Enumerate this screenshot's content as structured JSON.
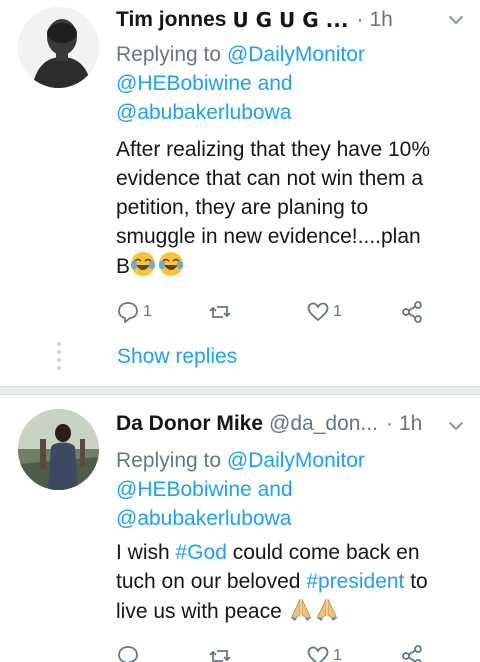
{
  "tweets": [
    {
      "name": "Tim jonnes",
      "name_suffix": "U G U G ...",
      "handle": "",
      "time": "1h",
      "replying_prefix": "Replying to",
      "mentions": [
        "@DailyMonitor",
        "@HEBobiwine",
        "@abubakerlubowa"
      ],
      "and_word": "and",
      "text_lines": [
        "After realizing that they have 10%",
        "evidence that can not win them a",
        "petition, they are planing to",
        "smuggle in new evidence!....plan"
      ],
      "last_line_text": "B",
      "last_line_emojis": [
        "face-with-tears-of-joy-icon",
        "face-with-tears-of-joy-icon"
      ],
      "reply_count": "1",
      "retweet_count": "",
      "like_count": "1",
      "show_replies_label": "Show replies"
    },
    {
      "name": "Da Donor Mike",
      "handle": "@da_don...",
      "time": "1h",
      "replying_prefix": "Replying to",
      "mentions": [
        "@DailyMonitor",
        "@HEBobiwine",
        "@abubakerlubowa"
      ],
      "and_word": "and",
      "line1_a": "I wish ",
      "line1_hashtag": "#God",
      "line1_b": " could come back en",
      "line2_a": "tuch on our beloved ",
      "line2_hashtag": "#president",
      "line2_b": " to",
      "line3_a": "live us with peace",
      "line3_emojis": [
        "folded-hands-icon",
        "folded-hands-icon"
      ],
      "reply_count": "",
      "retweet_count": "",
      "like_count": "1"
    }
  ],
  "colors": {
    "accent": "#1da1f2",
    "secondary": "#657786",
    "text": "#14171a",
    "divider": "#e6ecf0"
  }
}
